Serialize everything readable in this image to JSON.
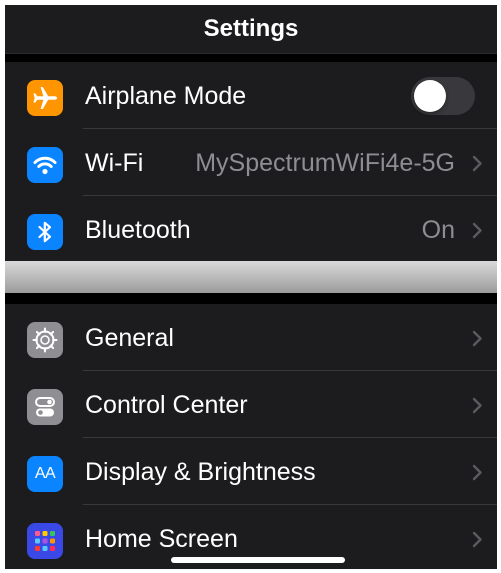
{
  "header": {
    "title": "Settings"
  },
  "group1": [
    {
      "label": "Airplane Mode",
      "icon": "airplane-icon",
      "icon_color": "#ff9500",
      "control": "toggle",
      "toggle_on": false
    },
    {
      "label": "Wi-Fi",
      "value": "MySpectrumWiFi4e-5G",
      "icon": "wifi-icon",
      "icon_color": "#0a84ff"
    },
    {
      "label": "Bluetooth",
      "value": "On",
      "icon": "bluetooth-icon",
      "icon_color": "#0a84ff"
    }
  ],
  "group2": [
    {
      "label": "General",
      "icon": "gear-icon",
      "icon_color": "#8e8e93"
    },
    {
      "label": "Control Center",
      "icon": "switches-icon",
      "icon_color": "#8e8e93"
    },
    {
      "label": "Display & Brightness",
      "icon": "text-size-icon",
      "icon_color": "#0a84ff",
      "icon_text": "AA"
    },
    {
      "label": "Home Screen",
      "icon": "app-grid-icon",
      "icon_color": "#3a49e6"
    }
  ],
  "colors": {
    "background": "#000000",
    "cell": "#1c1c1e",
    "separator": "#38383a",
    "secondary_text": "#8d8d92"
  }
}
